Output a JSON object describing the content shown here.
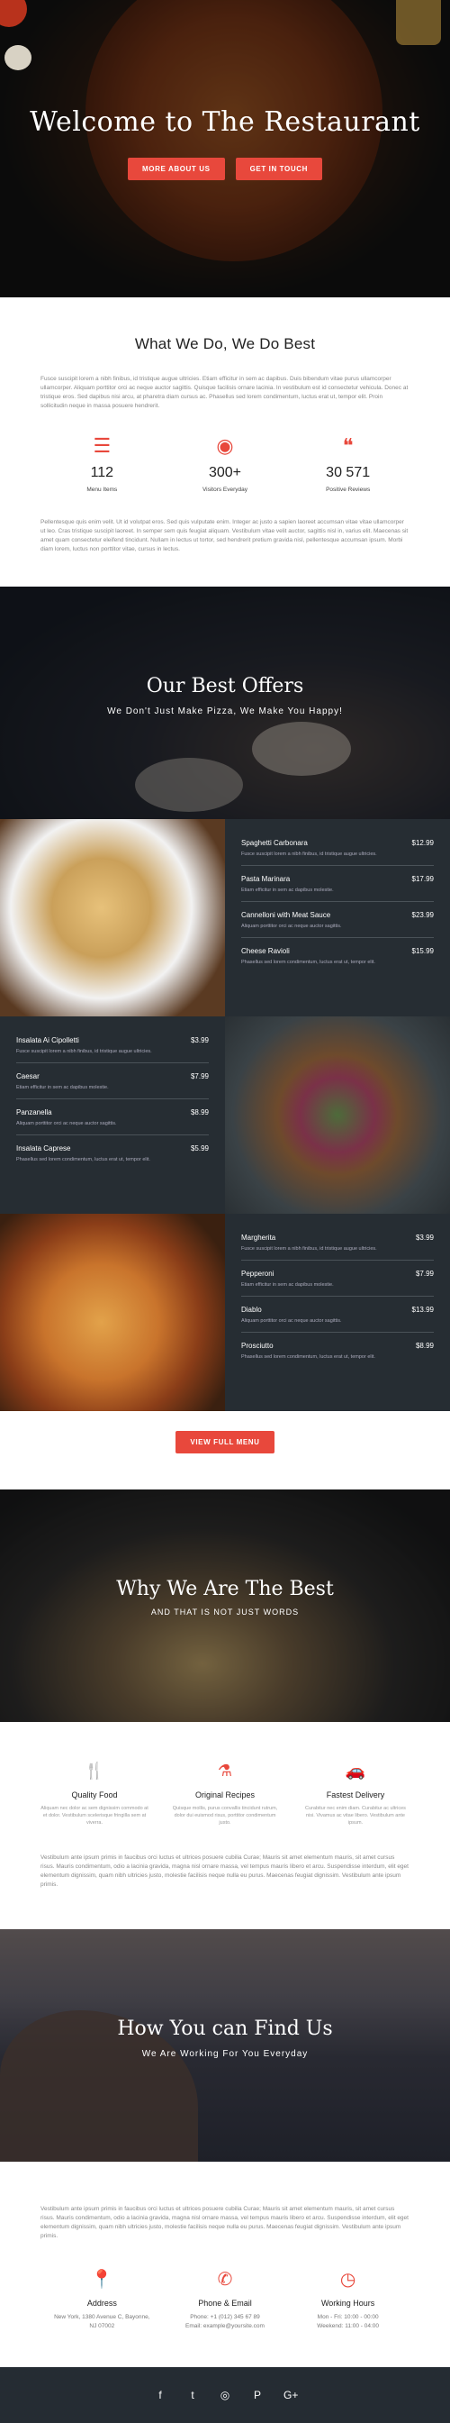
{
  "hero": {
    "title": "Welcome to The Restaurant",
    "btn_more": "MORE ABOUT US",
    "btn_touch": "GET IN TOUCH"
  },
  "about": {
    "title": "What We Do, We Do Best",
    "para1": "Fusce suscipit lorem a nibh finibus, id tristique augue ultricies. Etiam efficitur in sem ac dapibus. Duis bibendum vitae purus ullamcorper ullamcorper. Aliquam porttitor orci ac neque auctor sagittis. Quisque facilisis ornare lacinia. In vestibulum est id consectetur vehicula. Donec at tristique eros. Sed dapibus nisi arcu, at pharetra diam cursus ac. Phasellus sed lorem condimentum, luctus erat ut, tempor elit. Proin sollicitudin neque in massa posuere hendrerit.",
    "stats": [
      {
        "icon": "list-icon",
        "num": "112",
        "label": "Menu Items"
      },
      {
        "icon": "user-icon",
        "num": "300+",
        "label": "Visitors Everyday"
      },
      {
        "icon": "comments-icon",
        "num": "30 571",
        "label": "Positive Reviews"
      }
    ],
    "para2": "Pellentesque quis enim velit. Ut id volutpat eros. Sed quis vulputate enim. Integer ac justo a sapien laoreet accumsan vitae vitae ullamcorper ut leo. Cras tristique suscipit laoreet. In semper sem quis feugiat aliquam. Vestibulum vitae velit auctor, sagittis nisl in, varius elit. Maecenas sit amet quam consectetur eleifend tincidunt. Nullam in lectus ut tortor, sed hendrerit pretium gravida nisl, pellentesque accumsan ipsum. Morbi diam lorem, luctus non porttitor vitae, cursus in lectus."
  },
  "offers": {
    "title": "Our Best Offers",
    "subtitle": "We Don't Just Make Pizza, We Make You Happy!"
  },
  "menu1": [
    {
      "name": "Spaghetti Carbonara",
      "price": "$12.99",
      "desc": "Fusce suscipit lorem a nibh finibus, id tristique augue ultricies."
    },
    {
      "name": "Pasta Marinara",
      "price": "$17.99",
      "desc": "Etiam efficitur in sem ac dapibus molestie."
    },
    {
      "name": "Cannelloni with Meat Sauce",
      "price": "$23.99",
      "desc": "Aliquam porttitor orci ac neque auctor sagittis."
    },
    {
      "name": "Cheese Ravioli",
      "price": "$15.99",
      "desc": "Phasellus sed lorem condimentum, luctus erat ut, tempor elit."
    }
  ],
  "menu2": [
    {
      "name": "Insalata Ai Cipolletti",
      "price": "$3.99",
      "desc": "Fusce suscipit lorem a nibh finibus, id tristique augue ultricies."
    },
    {
      "name": "Caesar",
      "price": "$7.99",
      "desc": "Etiam efficitur in sem ac dapibus molestie."
    },
    {
      "name": "Panzanella",
      "price": "$8.99",
      "desc": "Aliquam porttitor orci ac neque auctor sagittis."
    },
    {
      "name": "Insalata Caprese",
      "price": "$5.99",
      "desc": "Phasellus sed lorem condimentum, luctus erat ut, tempor elit."
    }
  ],
  "menu3": [
    {
      "name": "Margherita",
      "price": "$3.99",
      "desc": "Fusce suscipit lorem a nibh finibus, id tristique augue ultricies."
    },
    {
      "name": "Pepperoni",
      "price": "$7.99",
      "desc": "Etiam efficitur in sem ac dapibus molestie."
    },
    {
      "name": "Diablo",
      "price": "$13.99",
      "desc": "Aliquam porttitor orci ac neque auctor sagittis."
    },
    {
      "name": "Prosciutto",
      "price": "$8.99",
      "desc": "Phasellus sed lorem condimentum, luctus erat ut, tempor elit."
    }
  ],
  "view_menu": "VIEW FULL MENU",
  "why": {
    "title": "Why We Are The Best",
    "subtitle": "AND THAT IS NOT JUST WORDS"
  },
  "features": [
    {
      "icon": "cutlery-icon",
      "title": "Quality Food",
      "desc": "Aliquam nec dolor ac sem dignissim commodo at et dolor. Vestibulum scelerisque fringilla sem at viverra."
    },
    {
      "icon": "flask-icon",
      "title": "Original Recipes",
      "desc": "Quisque mollis, purus convallis tincidunt rutrum, dolor dui euismod risus, porttitor condimentum justo."
    },
    {
      "icon": "car-icon",
      "title": "Fastest Delivery",
      "desc": "Curabitur nec enim diam. Curabitur ac ultrices nisi. Vivamus ac vitae libero. Vestibulum ante ipsum."
    }
  ],
  "why_para": "Vestibulum ante ipsum primis in faucibus orci luctus et ultrices posuere cubilia Curae; Mauris sit amet elementum mauris, sit amet cursus risus. Mauris condimentum, odio a lacinia gravida, magna nisl ornare massa, vel tempus mauris libero et arcu. Suspendisse interdum, elit eget elementum dignissim, quam nibh ultricies justo, molestie facilisis neque nulla eu purus. Maecenas feugiat dignissim. Vestibulum ante ipsum primis.",
  "find": {
    "title": "How You can Find Us",
    "subtitle": "We Are Working For You Everyday"
  },
  "find_para": "Vestibulum ante ipsum primis in faucibus orci luctus et ultrices posuere cubilia Curae; Mauris sit amet elementum mauris, sit amet cursus risus. Mauris condimentum, odio a lacinia gravida, magna nisl ornare massa, vel tempus mauris libero et arcu. Suspendisse interdum, elit eget elementum dignissim, quam nibh ultricies justo, molestie facilisis neque nulla eu purus. Maecenas feugiat dignissim. Vestibulum ante ipsum primis.",
  "contact": [
    {
      "icon": "map-marker-icon",
      "title": "Address",
      "line1": "New York, 1380 Avenue C, Bayonne,",
      "line2": "NJ 07002"
    },
    {
      "icon": "phone-icon",
      "title": "Phone & Email",
      "line1": "Phone: +1 (012) 345 67 89",
      "line2": "Email: example@yoursite.com"
    },
    {
      "icon": "clock-icon",
      "title": "Working Hours",
      "line1": "Mon - Fri: 10:00 - 00:00",
      "line2": "Weekend: 11:00 - 04:00"
    }
  ],
  "footer": {
    "social": [
      "f",
      "t",
      "◎",
      "P",
      "G+"
    ]
  }
}
